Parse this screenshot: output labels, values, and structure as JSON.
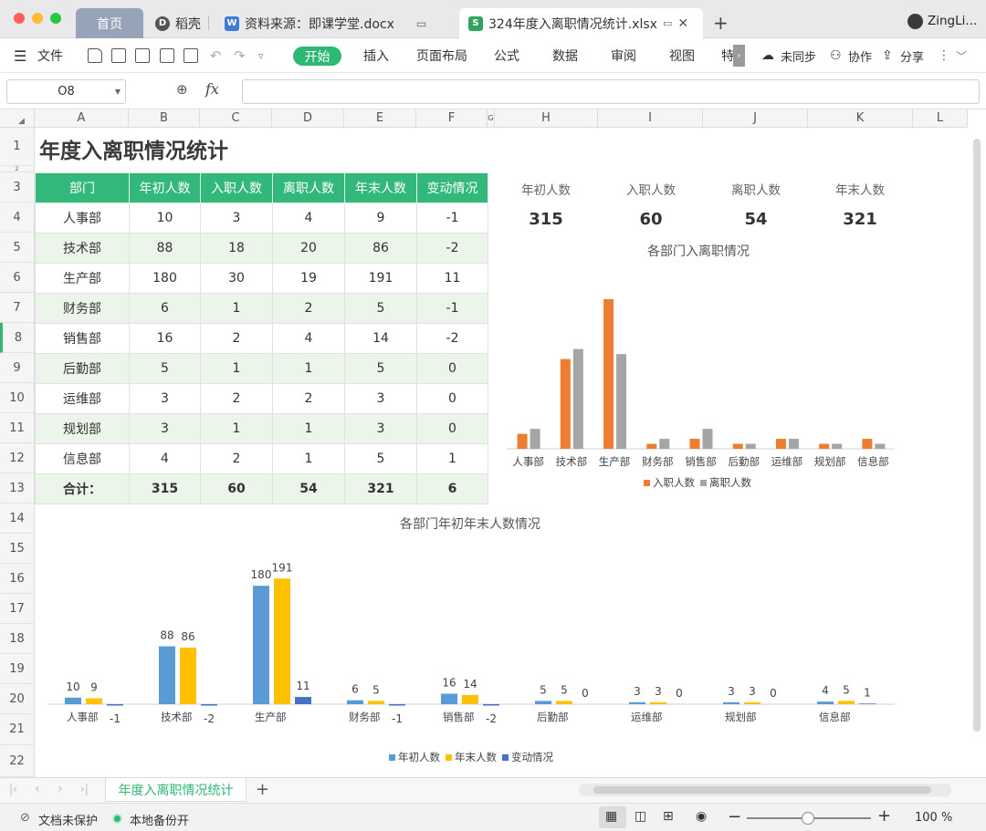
{
  "window": {
    "tabs": [
      {
        "label": "首页"
      },
      {
        "label": "稻壳"
      },
      {
        "label": "资料来源：即课学堂.docx"
      },
      {
        "label": "324年度入离职情况统计.xlsx"
      }
    ],
    "user": "ZingLi..."
  },
  "menu": {
    "file": "文件",
    "items": [
      "开始",
      "插入",
      "页面布局",
      "公式",
      "数据",
      "审阅",
      "视图",
      "特"
    ],
    "sync": "未同步",
    "collab": "协作",
    "share": "分享"
  },
  "formula_bar": {
    "cell_ref": "O8",
    "fx": "fx",
    "value": ""
  },
  "columns": [
    "A",
    "B",
    "C",
    "D",
    "E",
    "F",
    "G",
    "H",
    "I",
    "J",
    "K",
    "L"
  ],
  "rows": [
    "1",
    "2",
    "3",
    "4",
    "5",
    "6",
    "7",
    "8",
    "9",
    "10",
    "11",
    "12",
    "13",
    "14",
    "15",
    "16",
    "17",
    "18",
    "19",
    "20",
    "21",
    "22"
  ],
  "sheet": {
    "title": "年度入离职情况统计",
    "table": {
      "headers": [
        "部门",
        "年初人数",
        "入职人数",
        "离职人数",
        "年末人数",
        "变动情况"
      ],
      "rows": [
        [
          "人事部",
          "10",
          "3",
          "4",
          "9",
          "-1"
        ],
        [
          "技术部",
          "88",
          "18",
          "20",
          "86",
          "-2"
        ],
        [
          "生产部",
          "180",
          "30",
          "19",
          "191",
          "11"
        ],
        [
          "财务部",
          "6",
          "1",
          "2",
          "5",
          "-1"
        ],
        [
          "销售部",
          "16",
          "2",
          "4",
          "14",
          "-2"
        ],
        [
          "后勤部",
          "5",
          "1",
          "1",
          "5",
          "0"
        ],
        [
          "运维部",
          "3",
          "2",
          "2",
          "3",
          "0"
        ],
        [
          "规划部",
          "3",
          "1",
          "1",
          "3",
          "0"
        ],
        [
          "信息部",
          "4",
          "2",
          "1",
          "5",
          "1"
        ]
      ],
      "total": [
        "合计：",
        "315",
        "60",
        "54",
        "321",
        "6"
      ]
    },
    "kpis": [
      {
        "label": "年初人数",
        "value": "315"
      },
      {
        "label": "入职人数",
        "value": "60"
      },
      {
        "label": "离职人数",
        "value": "54"
      },
      {
        "label": "年末人数",
        "value": "321"
      }
    ]
  },
  "chart_data": [
    {
      "type": "bar",
      "title": "各部门入离职情况",
      "categories": [
        "人事部",
        "技术部",
        "生产部",
        "财务部",
        "销售部",
        "后勤部",
        "运维部",
        "规划部",
        "信息部"
      ],
      "series": [
        {
          "name": "入职人数",
          "values": [
            3,
            18,
            30,
            1,
            2,
            1,
            2,
            1,
            2
          ],
          "color": "#ed7d31"
        },
        {
          "name": "离职人数",
          "values": [
            4,
            20,
            19,
            2,
            4,
            1,
            2,
            1,
            1
          ],
          "color": "#a5a5a5"
        }
      ],
      "ylim": [
        0,
        30
      ],
      "legend": "bottom"
    },
    {
      "type": "bar",
      "title": "各部门年初年末人数情况",
      "categories": [
        "人事部",
        "技术部",
        "生产部",
        "财务部",
        "销售部",
        "后勤部",
        "运维部",
        "规划部",
        "信息部"
      ],
      "series": [
        {
          "name": "年初人数",
          "values": [
            10,
            88,
            180,
            6,
            16,
            5,
            3,
            3,
            4
          ],
          "color": "#5b9bd5"
        },
        {
          "name": "年末人数",
          "values": [
            9,
            86,
            191,
            5,
            14,
            5,
            3,
            3,
            5
          ],
          "color": "#ffc000"
        },
        {
          "name": "变动情况",
          "values": [
            -1,
            -2,
            11,
            -1,
            -2,
            0,
            0,
            0,
            1
          ],
          "color": "#4472c4"
        }
      ],
      "ylim": [
        -5,
        191
      ],
      "legend": "bottom"
    }
  ],
  "sheet_tabs": [
    {
      "label": "年度入离职情况统计"
    }
  ],
  "status": {
    "protect": "文档未保护",
    "backup": "本地备份开",
    "zoom": "100 %"
  }
}
